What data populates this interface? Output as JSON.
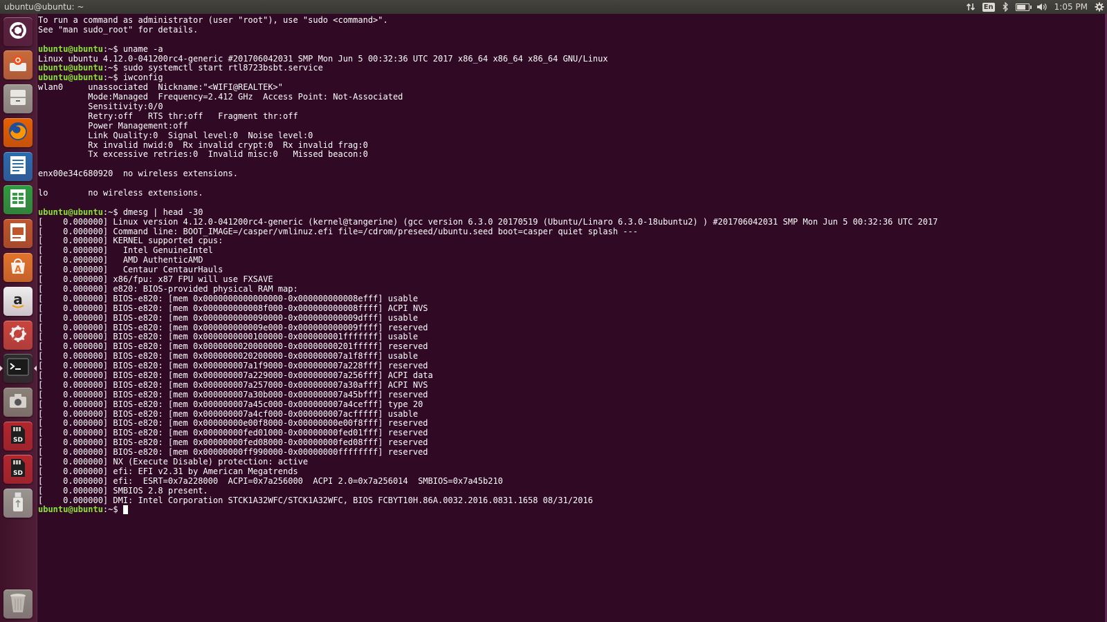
{
  "topbar": {
    "title": "ubuntu@ubuntu: ~",
    "indicators": {
      "network_icon": "network-transfer-icon",
      "keyboard_label": "En",
      "bluetooth_icon": "bluetooth-icon",
      "battery_icon": "battery-icon",
      "battery_level": 0.8,
      "volume_icon": "volume-icon",
      "clock": "1:05 PM",
      "settings_icon": "gear-icon"
    }
  },
  "launcher": {
    "items": [
      {
        "name": "dash-home",
        "icon": "ubuntu-logo-icon",
        "color": "#5a2240"
      },
      {
        "name": "install-ubuntu",
        "icon": "installer-icon",
        "color": "#c86b3c"
      },
      {
        "name": "files",
        "icon": "file-cabinet-icon",
        "color": "#9c9990"
      },
      {
        "name": "firefox",
        "icon": "firefox-icon",
        "color": "#e66000"
      },
      {
        "name": "libreoffice-writer",
        "icon": "writer-icon",
        "color": "#2a6cb0"
      },
      {
        "name": "libreoffice-calc",
        "icon": "calc-icon",
        "color": "#2e9c3f"
      },
      {
        "name": "libreoffice-impress",
        "icon": "impress-icon",
        "color": "#c0562b"
      },
      {
        "name": "ubuntu-software",
        "icon": "software-center-icon",
        "color": "#e2742b"
      },
      {
        "name": "amazon",
        "icon": "amazon-icon",
        "color": "#eeeeee"
      },
      {
        "name": "system-settings",
        "icon": "system-settings-icon",
        "color": "#c9453d"
      },
      {
        "name": "terminal",
        "icon": "terminal-icon",
        "color": "#2d2d2d"
      },
      {
        "name": "camera",
        "icon": "camera-icon",
        "color": "#8a8278"
      },
      {
        "name": "sd-card-1",
        "icon": "sd-card-icon",
        "color": "#b3262d"
      },
      {
        "name": "sd-card-2",
        "icon": "sd-card-icon",
        "color": "#b3262d"
      },
      {
        "name": "usb-drive",
        "icon": "usb-drive-icon",
        "color": "#9a9690"
      },
      {
        "name": "trash",
        "icon": "trash-icon",
        "color": "#8f8b84"
      }
    ],
    "sd_label": "SD"
  },
  "terminal": {
    "prompt_user": "ubuntu@ubuntu",
    "prompt_path": ":~$",
    "lines": [
      {
        "t": "out",
        "text": "To run a command as administrator (user \"root\"), use \"sudo <command>\"."
      },
      {
        "t": "out",
        "text": "See \"man sudo_root\" for details."
      },
      {
        "t": "out",
        "text": ""
      },
      {
        "t": "cmd",
        "text": " uname -a"
      },
      {
        "t": "out",
        "text": "Linux ubuntu 4.12.0-041200rc4-generic #201706042031 SMP Mon Jun 5 00:32:36 UTC 2017 x86_64 x86_64 x86_64 GNU/Linux"
      },
      {
        "t": "cmd",
        "text": " sudo systemctl start rtl8723bsbt.service"
      },
      {
        "t": "cmd",
        "text": " iwconfig"
      },
      {
        "t": "out",
        "text": "wlan0     unassociated  Nickname:\"<WIFI@REALTEK>\""
      },
      {
        "t": "out",
        "text": "          Mode:Managed  Frequency=2.412 GHz  Access Point: Not-Associated"
      },
      {
        "t": "out",
        "text": "          Sensitivity:0/0"
      },
      {
        "t": "out",
        "text": "          Retry:off   RTS thr:off   Fragment thr:off"
      },
      {
        "t": "out",
        "text": "          Power Management:off"
      },
      {
        "t": "out",
        "text": "          Link Quality:0  Signal level:0  Noise level:0"
      },
      {
        "t": "out",
        "text": "          Rx invalid nwid:0  Rx invalid crypt:0  Rx invalid frag:0"
      },
      {
        "t": "out",
        "text": "          Tx excessive retries:0  Invalid misc:0   Missed beacon:0"
      },
      {
        "t": "out",
        "text": ""
      },
      {
        "t": "out",
        "text": "enx00e34c680920  no wireless extensions."
      },
      {
        "t": "out",
        "text": ""
      },
      {
        "t": "out",
        "text": "lo        no wireless extensions."
      },
      {
        "t": "out",
        "text": ""
      },
      {
        "t": "cmd",
        "text": " dmesg | head -30"
      },
      {
        "t": "out",
        "text": "[    0.000000] Linux version 4.12.0-041200rc4-generic (kernel@tangerine) (gcc version 6.3.0 20170519 (Ubuntu/Linaro 6.3.0-18ubuntu2) ) #201706042031 SMP Mon Jun 5 00:32:36 UTC 2017"
      },
      {
        "t": "out",
        "text": "[    0.000000] Command line: BOOT_IMAGE=/casper/vmlinuz.efi file=/cdrom/preseed/ubuntu.seed boot=casper quiet splash ---"
      },
      {
        "t": "out",
        "text": "[    0.000000] KERNEL supported cpus:"
      },
      {
        "t": "out",
        "text": "[    0.000000]   Intel GenuineIntel"
      },
      {
        "t": "out",
        "text": "[    0.000000]   AMD AuthenticAMD"
      },
      {
        "t": "out",
        "text": "[    0.000000]   Centaur CentaurHauls"
      },
      {
        "t": "out",
        "text": "[    0.000000] x86/fpu: x87 FPU will use FXSAVE"
      },
      {
        "t": "out",
        "text": "[    0.000000] e820: BIOS-provided physical RAM map:"
      },
      {
        "t": "out",
        "text": "[    0.000000] BIOS-e820: [mem 0x0000000000000000-0x000000000008efff] usable"
      },
      {
        "t": "out",
        "text": "[    0.000000] BIOS-e820: [mem 0x000000000008f000-0x000000000008ffff] ACPI NVS"
      },
      {
        "t": "out",
        "text": "[    0.000000] BIOS-e820: [mem 0x0000000000090000-0x000000000009dfff] usable"
      },
      {
        "t": "out",
        "text": "[    0.000000] BIOS-e820: [mem 0x000000000009e000-0x000000000009ffff] reserved"
      },
      {
        "t": "out",
        "text": "[    0.000000] BIOS-e820: [mem 0x0000000000100000-0x000000001fffffff] usable"
      },
      {
        "t": "out",
        "text": "[    0.000000] BIOS-e820: [mem 0x0000000020000000-0x00000000201fffff] reserved"
      },
      {
        "t": "out",
        "text": "[    0.000000] BIOS-e820: [mem 0x0000000020200000-0x000000007a1f8fff] usable"
      },
      {
        "t": "out",
        "text": "[    0.000000] BIOS-e820: [mem 0x000000007a1f9000-0x000000007a228fff] reserved"
      },
      {
        "t": "out",
        "text": "[    0.000000] BIOS-e820: [mem 0x000000007a229000-0x000000007a256fff] ACPI data"
      },
      {
        "t": "out",
        "text": "[    0.000000] BIOS-e820: [mem 0x000000007a257000-0x000000007a30afff] ACPI NVS"
      },
      {
        "t": "out",
        "text": "[    0.000000] BIOS-e820: [mem 0x000000007a30b000-0x000000007a45bfff] reserved"
      },
      {
        "t": "out",
        "text": "[    0.000000] BIOS-e820: [mem 0x000000007a45c000-0x000000007a4cefff] type 20"
      },
      {
        "t": "out",
        "text": "[    0.000000] BIOS-e820: [mem 0x000000007a4cf000-0x000000007acfffff] usable"
      },
      {
        "t": "out",
        "text": "[    0.000000] BIOS-e820: [mem 0x00000000e00f8000-0x00000000e00f8fff] reserved"
      },
      {
        "t": "out",
        "text": "[    0.000000] BIOS-e820: [mem 0x00000000fed01000-0x00000000fed01fff] reserved"
      },
      {
        "t": "out",
        "text": "[    0.000000] BIOS-e820: [mem 0x00000000fed08000-0x00000000fed08fff] reserved"
      },
      {
        "t": "out",
        "text": "[    0.000000] BIOS-e820: [mem 0x00000000ff990000-0x00000000ffffffff] reserved"
      },
      {
        "t": "out",
        "text": "[    0.000000] NX (Execute Disable) protection: active"
      },
      {
        "t": "out",
        "text": "[    0.000000] efi: EFI v2.31 by American Megatrends"
      },
      {
        "t": "out",
        "text": "[    0.000000] efi:  ESRT=0x7a228000  ACPI=0x7a256000  ACPI 2.0=0x7a256014  SMBIOS=0x7a45b210"
      },
      {
        "t": "out",
        "text": "[    0.000000] SMBIOS 2.8 present."
      },
      {
        "t": "out",
        "text": "[    0.000000] DMI: Intel Corporation STCK1A32WFC/STCK1A32WFC, BIOS FCBYT10H.86A.0032.2016.0831.1658 08/31/2016"
      },
      {
        "t": "prompt",
        "text": " "
      }
    ]
  },
  "colors": {
    "terminal_bg": "#300a24",
    "prompt": "#8ae234",
    "launcher_bg": "#4a1a33",
    "panel_bg": "#3c3b37"
  }
}
